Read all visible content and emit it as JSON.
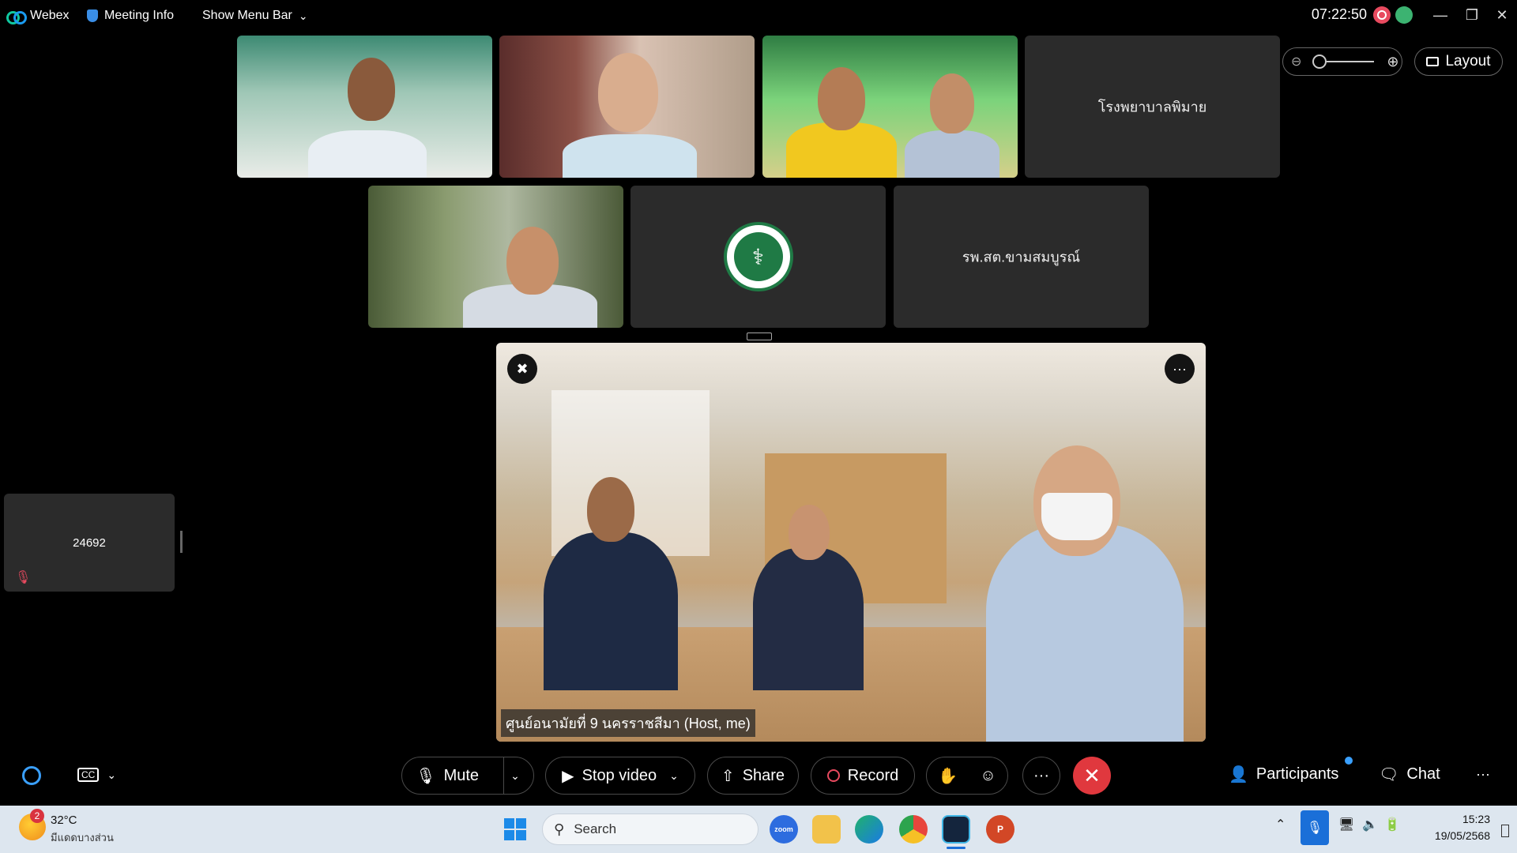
{
  "topbar": {
    "app_name": "Webex",
    "meeting_info": "Meeting Info",
    "show_menu_bar": "Show Menu Bar",
    "clock": "07:22:50",
    "window_controls": [
      "—",
      "❐",
      "✕"
    ]
  },
  "gallery": {
    "tiles": [
      {
        "name": "",
        "type": "video"
      },
      {
        "name": "",
        "type": "video"
      },
      {
        "name": "",
        "type": "video"
      },
      {
        "name": "โรงพยาบาลพิมาย",
        "type": "name"
      },
      {
        "name": "",
        "type": "video"
      },
      {
        "name": "",
        "type": "logo",
        "logo_text": "MINISTRY OF PUBLIC HEALTH"
      },
      {
        "name": "รพ.สต.ขามสมบูรณ์",
        "type": "name"
      }
    ]
  },
  "view_controls": {
    "layout_label": "Layout"
  },
  "stage": {
    "speaker_label": "ศูนย์อนามัยที่ 9 นครราชสีมา (Host, me)"
  },
  "self_view": {
    "name": "24692",
    "muted": true
  },
  "controls": {
    "mute": "Mute",
    "stop_video": "Stop video",
    "share": "Share",
    "record": "Record",
    "participants": "Participants",
    "chat": "Chat",
    "more": "···"
  },
  "taskbar": {
    "weather_temp": "32°C",
    "weather_desc": "มีแดดบางส่วน",
    "weather_badge": "2",
    "search_placeholder": "Search",
    "time": "15:23",
    "date": "19/05/2568",
    "apps": [
      "zoom",
      "file-explorer",
      "edge",
      "chrome",
      "webex",
      "powerpoint"
    ]
  },
  "colors": {
    "end_call": "#e0383e",
    "tile_bg": "#2b2b2b",
    "taskbar_bg": "#dde6ef",
    "mic_active": "#1a6fd8"
  }
}
